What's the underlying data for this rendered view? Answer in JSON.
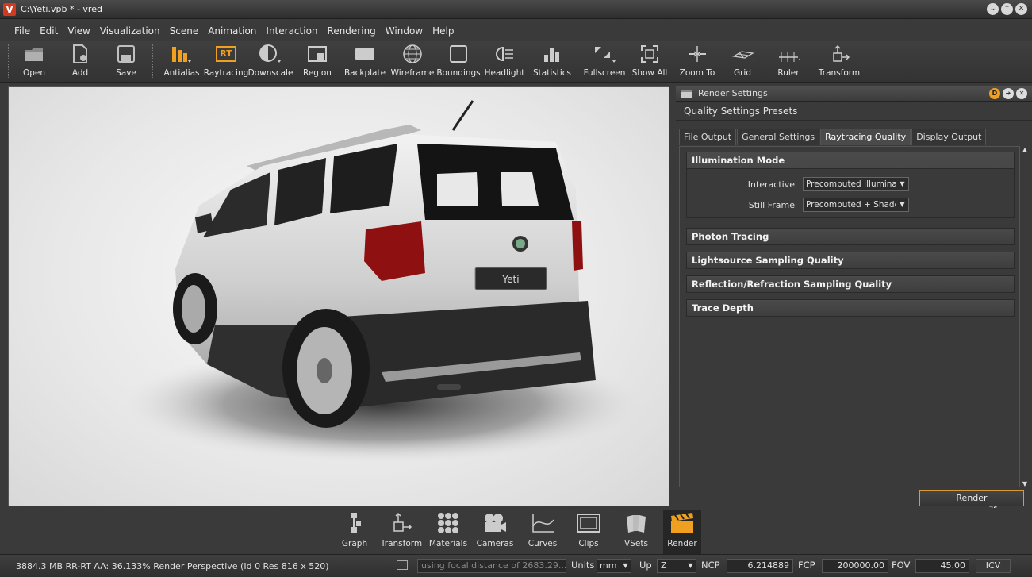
{
  "window": {
    "title": "C:\\Yeti.vpb * - vred",
    "logo": "V"
  },
  "menu": [
    "File",
    "Edit",
    "View",
    "Visualization",
    "Scene",
    "Animation",
    "Interaction",
    "Rendering",
    "Window",
    "Help"
  ],
  "toolbar": {
    "open": "Open",
    "add": "Add",
    "save": "Save",
    "antialias": "Antialias",
    "raytracing": "Raytracing",
    "raytracing_badge": "RT",
    "downscale": "Downscale",
    "region": "Region",
    "backplate": "Backplate",
    "wireframe": "Wireframe",
    "boundings": "Boundings",
    "headlight": "Headlight",
    "statistics": "Statistics",
    "fullscreen": "Fullscreen",
    "show_all": "Show All",
    "zoom_to": "Zoom To",
    "grid": "Grid",
    "ruler": "Ruler",
    "transform": "Transform"
  },
  "viewport": {
    "plate_text": "Yeti"
  },
  "render_settings": {
    "title": "Render Settings",
    "presets": "Quality Settings Presets",
    "tabs": [
      "File Output",
      "General Settings",
      "Raytracing Quality",
      "Display Output"
    ],
    "active_tab": "Raytracing Quality",
    "sections": {
      "illumination": "Illumination Mode",
      "photon": "Photon Tracing",
      "lightsource": "Lightsource Sampling Quality",
      "reflection": "Reflection/Refraction Sampling Quality",
      "trace_depth": "Trace Depth"
    },
    "interactive_label": "Interactive",
    "interactive_value": "Precomputed Illuminat",
    "still_label": "Still Frame",
    "still_value": "Precomputed + Shadc",
    "render_button": "Render",
    "render_counter": "36"
  },
  "dock": {
    "graph": "Graph",
    "transform": "Transform",
    "materials": "Materials",
    "cameras": "Cameras",
    "curves": "Curves",
    "clips": "Clips",
    "vsets": "VSets",
    "render": "Render"
  },
  "status": {
    "text": "3884.3 MB  RR-RT AA: 36.133%  Render Perspective (Id 0 Res 816 x 520)",
    "focal": "using focal distance of 2683.29...",
    "units_label": "Units",
    "units_value": "mm",
    "up_label": "Up",
    "up_value": "Z",
    "ncp_label": "NCP",
    "ncp_value": "6.214889",
    "fcp_label": "FCP",
    "fcp_value": "200000.00",
    "fov_label": "FOV",
    "fov_value": "45.00",
    "icv": "ICV"
  },
  "colors": {
    "accent": "#f0a020",
    "logo": "#d23a1f"
  }
}
